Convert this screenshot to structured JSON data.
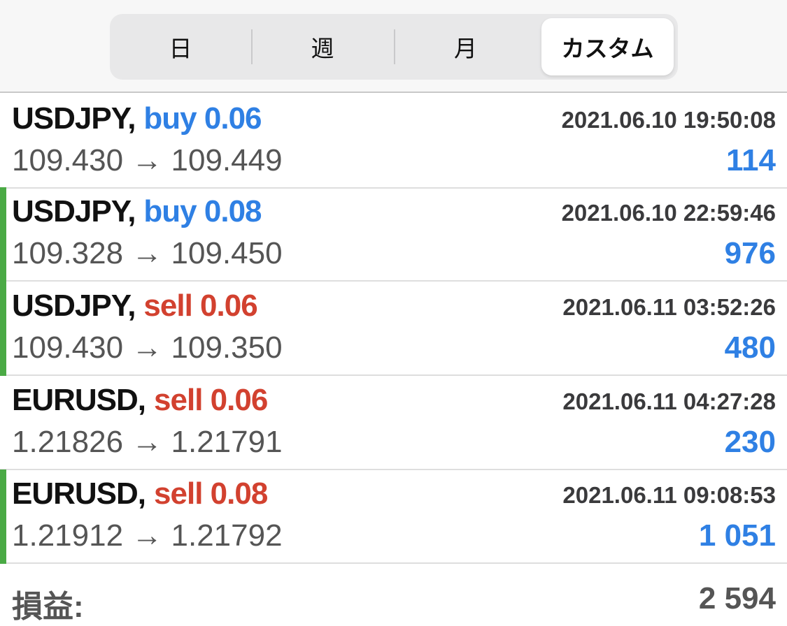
{
  "period_tabs": [
    {
      "label": "日"
    },
    {
      "label": "週"
    },
    {
      "label": "月"
    },
    {
      "label": "カスタム",
      "selected": true
    }
  ],
  "trades": [
    {
      "symbol": "USDJPY,",
      "direction": "buy",
      "direction_label": "buy 0.06",
      "time": "2021.06.10 19:50:08",
      "prices": "109.430 → 109.449",
      "profit": "114",
      "green_marker": false
    },
    {
      "symbol": "USDJPY,",
      "direction": "buy",
      "direction_label": "buy 0.08",
      "time": "2021.06.10 22:59:46",
      "prices": "109.328 → 109.450",
      "profit": "976",
      "green_marker": true
    },
    {
      "symbol": "USDJPY,",
      "direction": "sell",
      "direction_label": "sell 0.06",
      "time": "2021.06.11 03:52:26",
      "prices": "109.430 → 109.350",
      "profit": "480",
      "green_marker": true
    },
    {
      "symbol": "EURUSD,",
      "direction": "sell",
      "direction_label": "sell 0.06",
      "time": "2021.06.11 04:27:28",
      "prices": "1.21826 → 1.21791",
      "profit": "230",
      "green_marker": false
    },
    {
      "symbol": "EURUSD,",
      "direction": "sell",
      "direction_label": "sell 0.08",
      "time": "2021.06.11 09:08:53",
      "prices": "1.21912 → 1.21792",
      "profit": "1 051",
      "green_marker": true
    }
  ],
  "summary": {
    "label": "損益:",
    "total": "2 594"
  },
  "colors": {
    "buy": "#2f80e4",
    "sell": "#d2412f",
    "profit": "#2f80e4",
    "marker": "#4aaa45"
  }
}
